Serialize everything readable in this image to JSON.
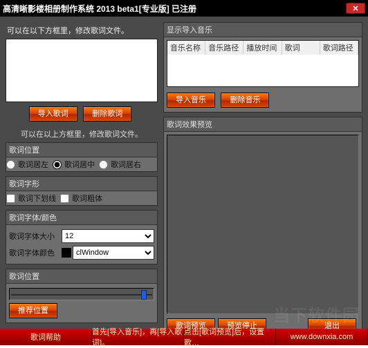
{
  "title": "高清晰影楼相册制作系统 2013 beta1[专业版] 已注册",
  "left": {
    "hint_above": "可以在以下方框里，修改歌词文件。",
    "import_lyric": "导入歌词",
    "delete_lyric": "删除歌词",
    "hint_below": "可以在以上方框里，修改歌词文件。",
    "pos_header": "歌词位置",
    "pos_left": "歌词居左",
    "pos_center": "歌词居中",
    "pos_right": "歌词居右",
    "shape_header": "歌词字形",
    "underline": "歌词下划线",
    "bold": "歌词粗体",
    "font_header": "歌词字体/颜色",
    "font_size_label": "歌词字体大小",
    "font_size_value": "12",
    "font_color_label": "歌词字体颜色",
    "font_color_value": "clWindow",
    "slider_header": "歌词位置",
    "recommend_btn": "推荐位置"
  },
  "right": {
    "music_header": "显示导入音乐",
    "th_name": "音乐名称",
    "th_path": "音乐路径",
    "th_time": "播放时间",
    "th_lyric": "歌词",
    "th_lyric_path": "歌词路径",
    "import_music": "导入音乐",
    "delete_music": "删除音乐",
    "preview_header": "歌词效果预览",
    "preview_btn": "歌词预览",
    "stop_btn": "预览停止",
    "exit_btn": "退出"
  },
  "bottom": {
    "help": "歌词帮助",
    "step1": "首先[导入音乐]，再[导入歌词]。",
    "step2": "点击[歌词预览]后，设置歌…",
    "source": "www.downxia.com"
  },
  "watermark": "当下软件园"
}
